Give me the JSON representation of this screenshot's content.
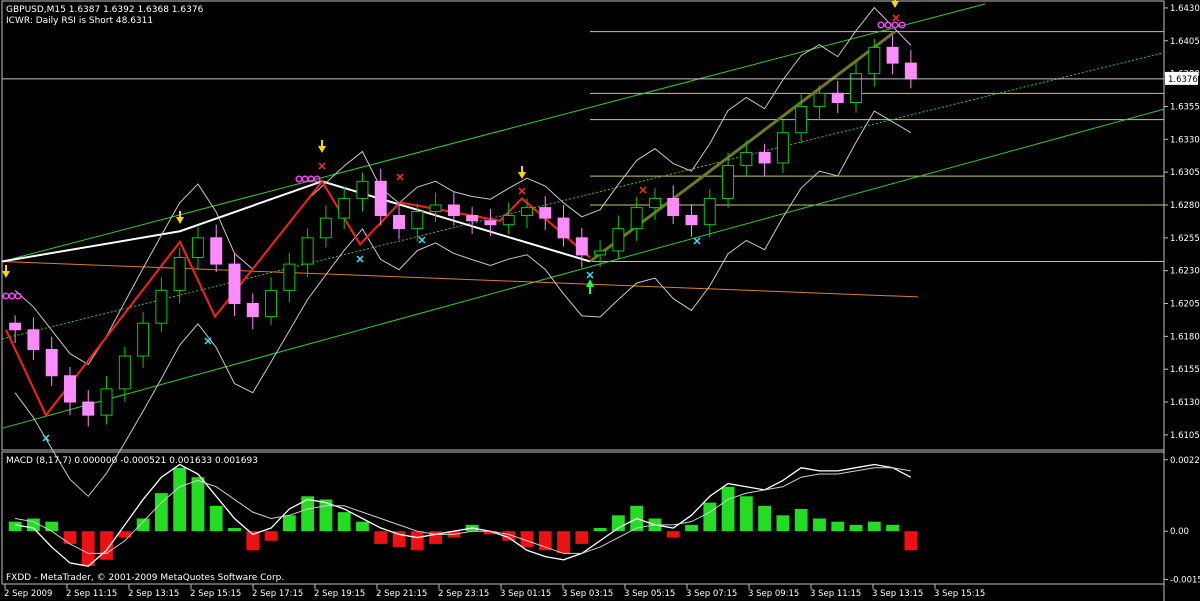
{
  "header": {
    "line1": "GBPUSD,M15  1.6387 1.6392 1.6368 1.6376",
    "line2": "ICWR: Daily RSI is Short 48.6311"
  },
  "macd_label": "MACD  (8,17,7) 0.000000 -0.000521 0.001633 0.001693",
  "copyright": "FXDD - MetaTrader, © 2001-2009 MetaQuotes Software Corp.",
  "price_tag": "1.6376",
  "colors": {
    "background": "#000000",
    "frame": "#c0c0c0",
    "bull": "#00cc00",
    "bear": "#ff8cff",
    "channel": "#33cc33",
    "level": "#c8c878",
    "zigzag": "#ff2020",
    "trend": "#ffffff",
    "orange": "#e08020",
    "band": "#c8c8c8",
    "hist_up": "#22dd22",
    "hist_down": "#ee1111",
    "signal": "#ffffff"
  },
  "chart_data": {
    "type": "candlestick",
    "symbol": "GBPUSD",
    "timeframe": "M15",
    "ylim": [
      1.6095,
      1.6433
    ],
    "y_ticks": [
      "1.6430",
      "1.6405",
      "1.6380",
      "1.6355",
      "1.6330",
      "1.6305",
      "1.6280",
      "1.6255",
      "1.6230",
      "1.6205",
      "1.6180",
      "1.6155",
      "1.6130",
      "1.6105"
    ],
    "x_ticks": [
      "2 Sep 2009",
      "2 Sep 11:15",
      "2 Sep 13:15",
      "2 Sep 15:15",
      "2 Sep 17:15",
      "2 Sep 19:15",
      "2 Sep 21:15",
      "2 Sep 23:15",
      "3 Sep 01:15",
      "3 Sep 03:15",
      "3 Sep 05:15",
      "3 Sep 07:15",
      "3 Sep 09:15",
      "3 Sep 11:15",
      "3 Sep 13:15",
      "3 Sep 15:15"
    ],
    "close_series": [
      1.6185,
      1.617,
      1.615,
      1.613,
      1.612,
      1.614,
      1.6165,
      1.619,
      1.6215,
      1.624,
      1.6255,
      1.6235,
      1.6205,
      1.6195,
      1.6215,
      1.6235,
      1.6255,
      1.627,
      1.6285,
      1.6298,
      1.6272,
      1.6262,
      1.6275,
      1.628,
      1.6272,
      1.6268,
      1.6265,
      1.6272,
      1.6278,
      1.627,
      1.6255,
      1.6242,
      1.6245,
      1.6262,
      1.6278,
      1.6285,
      1.6272,
      1.6265,
      1.6285,
      1.631,
      1.632,
      1.6312,
      1.6335,
      1.6355,
      1.6365,
      1.6358,
      1.638,
      1.64,
      1.6388,
      1.6376
    ],
    "current_price": 1.6376,
    "macd": {
      "params": "8,17,7",
      "ylim": [
        -0.0016,
        0.0024
      ],
      "y_ticks": [
        "0.00225",
        "0.00",
        "-0.00152"
      ],
      "histogram": [
        0.0003,
        0.0004,
        0.0003,
        -0.0004,
        -0.0011,
        -0.0009,
        -0.0002,
        0.0004,
        0.0012,
        0.002,
        0.0017,
        0.0008,
        0.0001,
        -0.0006,
        -0.0003,
        0.0005,
        0.0011,
        0.001,
        0.0006,
        0.0003,
        -0.0004,
        -0.0005,
        -0.0006,
        -0.0004,
        -0.0002,
        0.0002,
        -0.0001,
        -0.0003,
        -0.0005,
        -0.0006,
        -0.0007,
        -0.0004,
        0.0001,
        0.0005,
        0.0008,
        0.0004,
        -0.0002,
        0.0002,
        0.0009,
        0.0014,
        0.0011,
        0.0008,
        0.0005,
        0.0007,
        0.0004,
        0.0003,
        0.0002,
        0.0003,
        0.0002,
        -0.0006
      ],
      "macd_line": [
        0.0002,
        0.0001,
        -0.0005,
        -0.001,
        -0.0011,
        -0.0006,
        0.0002,
        0.001,
        0.0017,
        0.0021,
        0.0018,
        0.0011,
        0.0004,
        -0.0001,
        0.0001,
        0.0007,
        0.001,
        0.0009,
        0.0007,
        0.0004,
        0.0001,
        -0.0001,
        -0.0002,
        -0.0001,
        0.0,
        0.0001,
        0.0,
        -0.0002,
        -0.0006,
        -0.0008,
        -0.0009,
        -0.0007,
        -0.0003,
        0.0001,
        0.0004,
        0.0002,
        0.0001,
        0.0005,
        0.0011,
        0.0015,
        0.0014,
        0.0013,
        0.0016,
        0.002,
        0.0019,
        0.0019,
        0.002,
        0.0021,
        0.002,
        0.0017
      ],
      "signal_line": [
        0.0004,
        0.0003,
        0.0,
        -0.0004,
        -0.0007,
        -0.0007,
        -0.0003,
        0.0003,
        0.0009,
        0.0014,
        0.0016,
        0.0014,
        0.001,
        0.0006,
        0.0004,
        0.0005,
        0.0007,
        0.0008,
        0.0008,
        0.0006,
        0.0004,
        0.0002,
        0.0,
        -0.0001,
        -0.0001,
        0.0,
        0.0,
        -0.0001,
        -0.0003,
        -0.0005,
        -0.0007,
        -0.0007,
        -0.0005,
        -0.0002,
        0.0001,
        0.0002,
        0.0002,
        0.0003,
        0.0006,
        0.001,
        0.0012,
        0.0013,
        0.0014,
        0.0017,
        0.0018,
        0.0018,
        0.0019,
        0.002,
        0.002,
        0.0019
      ]
    }
  }
}
